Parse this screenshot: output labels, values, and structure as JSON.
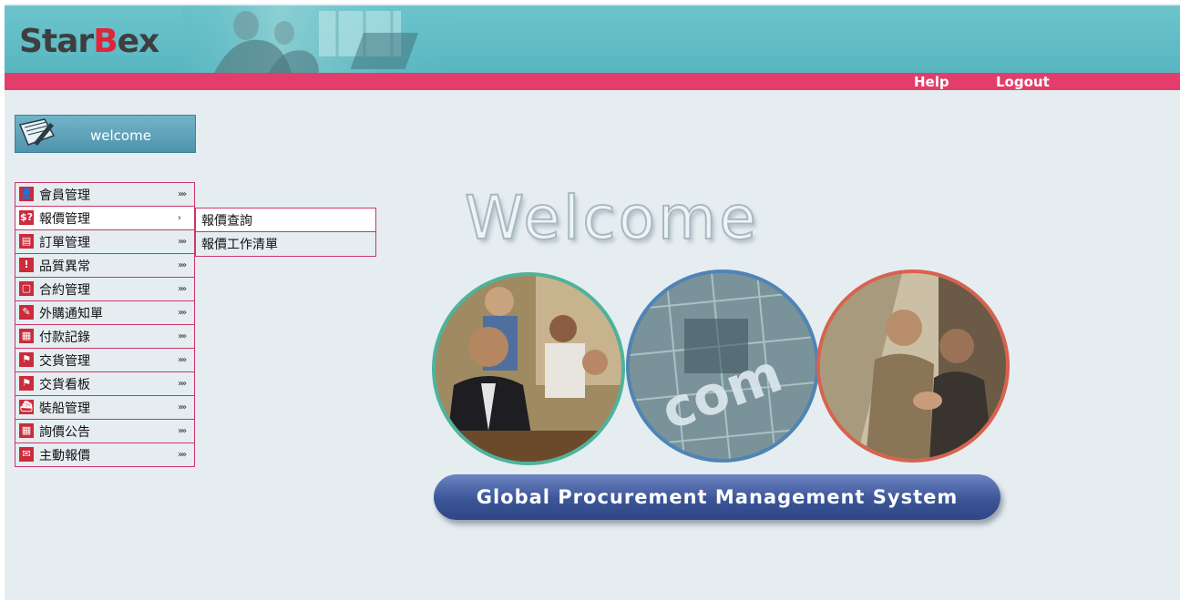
{
  "header": {
    "logo_prefix": "Star",
    "logo_b": "B",
    "logo_suffix": "ex",
    "brand_color": "#e0253a",
    "header_color": "#5dbac3",
    "navbar_color": "#e33d6b"
  },
  "nav": {
    "help": "Help",
    "logout": "Logout"
  },
  "welcome_box": {
    "label": "welcome",
    "icon": "pen-notepad-icon"
  },
  "menu": {
    "items": [
      {
        "label": "會員管理",
        "icon": "member-icon",
        "arrow": "»»"
      },
      {
        "label": "報價管理",
        "icon": "quote-icon",
        "arrow": "›",
        "active": true
      },
      {
        "label": "訂單管理",
        "icon": "order-icon",
        "arrow": "»»"
      },
      {
        "label": "品質異常",
        "icon": "quality-icon",
        "arrow": "»»"
      },
      {
        "label": "合約管理",
        "icon": "contract-icon",
        "arrow": "»»"
      },
      {
        "label": "外購通知單",
        "icon": "purchase-notice-icon",
        "arrow": "»»"
      },
      {
        "label": "付款記錄",
        "icon": "payment-icon",
        "arrow": "»»"
      },
      {
        "label": "交貨管理",
        "icon": "delivery-icon",
        "arrow": "»»"
      },
      {
        "label": "交貨看板",
        "icon": "delivery-board-icon",
        "arrow": "»»"
      },
      {
        "label": "裝船管理",
        "icon": "shipping-icon",
        "arrow": "»»"
      },
      {
        "label": "詢價公告",
        "icon": "inquiry-icon",
        "arrow": "»»"
      },
      {
        "label": "主動報價",
        "icon": "active-quote-icon",
        "arrow": "»»"
      }
    ],
    "icon_glyphs": [
      "👤",
      "$?",
      "▤",
      "!",
      "▢",
      "✎",
      "▦",
      "⚑",
      "⚑",
      "⛴",
      "▦",
      "✉"
    ]
  },
  "submenu": {
    "items": [
      {
        "label": "報價查詢"
      },
      {
        "label": "報價工作清單"
      }
    ]
  },
  "hero": {
    "title": "Welcome",
    "banner": "Global Procurement Management System",
    "circle_colors": [
      "#4fb39a",
      "#4f84b6",
      "#d9624f"
    ]
  }
}
